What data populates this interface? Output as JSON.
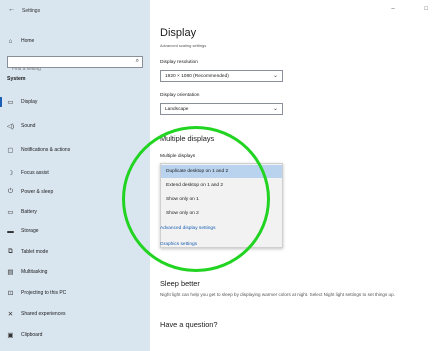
{
  "window": {
    "title": "Settings",
    "controls": "– □"
  },
  "sidebar": {
    "home_label": "Home",
    "search_placeholder": "Find a setting",
    "section_label": "System",
    "items": [
      {
        "label": "Display",
        "icon": "monitor-icon"
      },
      {
        "label": "Sound",
        "icon": "speaker-icon"
      },
      {
        "label": "Notifications & actions",
        "icon": "notification-icon"
      },
      {
        "label": "Focus assist",
        "icon": "moon-icon"
      },
      {
        "label": "Power & sleep",
        "icon": "power-icon"
      },
      {
        "label": "Battery",
        "icon": "battery-icon"
      },
      {
        "label": "Storage",
        "icon": "storage-icon"
      },
      {
        "label": "Tablet mode",
        "icon": "tablet-icon"
      },
      {
        "label": "Multitasking",
        "icon": "multitasking-icon"
      },
      {
        "label": "Projecting to this PC",
        "icon": "projector-icon"
      },
      {
        "label": "Shared experiences",
        "icon": "shared-icon"
      },
      {
        "label": "Clipboard",
        "icon": "clipboard-icon"
      }
    ],
    "selected_index": 0
  },
  "main": {
    "page_title": "Display",
    "cut_text": "Advanced scaling settings",
    "resolution": {
      "label": "Display resolution",
      "value": "1920 × 1080 (Recommended)"
    },
    "orientation": {
      "label": "Display orientation",
      "value": "Landscape"
    },
    "multiple_displays": {
      "heading": "Multiple displays",
      "label": "Multiple displays",
      "options": [
        "Duplicate desktop on 1 and 2",
        "Extend desktop on 1 and 2",
        "Show only on 1",
        "Show only on 2"
      ],
      "selected_index": 0
    },
    "advanced_link": "Advanced display settings",
    "graphics_link": "Graphics settings",
    "sleep_heading": "Sleep better",
    "sleep_text": "Night light can help you get to sleep by displaying warmer colors at night. Select Night light settings to set things up.",
    "question_heading": "Have a question?"
  },
  "colors": {
    "sidebar_bg": "#d9e5ef",
    "accent": "#1a5fb4",
    "highlight_ring": "#22d422",
    "selected_option": "#b9d3ef"
  }
}
